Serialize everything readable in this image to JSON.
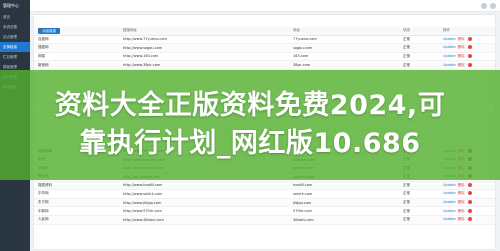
{
  "sidebar": {
    "brand": "管理中心",
    "items": [
      {
        "label": "首页",
        "active": false
      },
      {
        "label": "系统设置",
        "active": false
      },
      {
        "label": "站点管理",
        "active": false
      },
      {
        "label": "友情链接",
        "active": true
      },
      {
        "label": "栏目管理",
        "active": false
      },
      {
        "label": "模板管理",
        "active": false
      },
      {
        "label": "用户管理",
        "active": false
      },
      {
        "label": "数据统计",
        "active": false
      }
    ]
  },
  "toolbar": {
    "add_label": "添加链接"
  },
  "table": {
    "headers": [
      "名称",
      "链接地址",
      "地址",
      "状态",
      "操作"
    ],
    "rows": [
      {
        "name": "百度网",
        "url": "http://www.77yueno.com",
        "url2": "77yueno.com",
        "status": "正常"
      },
      {
        "name": "搜狐网",
        "url": "http://www.sogou.com",
        "url2": "sogou.com",
        "status": "正常"
      },
      {
        "name": "网易",
        "url": "http://www.163.com",
        "url2": "163.com",
        "status": "正常"
      },
      {
        "name": "新浪网",
        "url": "http://www.38pc.com",
        "url2": "38pc.com",
        "status": "正常"
      },
      {
        "name": "",
        "url": "",
        "url2": "",
        "status": ""
      },
      {
        "name": "",
        "url": "",
        "url2": "",
        "status": ""
      },
      {
        "name": "",
        "url": "",
        "url2": "",
        "status": ""
      },
      {
        "name": "",
        "url": "",
        "url2": "",
        "status": ""
      },
      {
        "name": "",
        "url": "",
        "url2": "",
        "status": ""
      },
      {
        "name": "",
        "url": "",
        "url2": "",
        "status": ""
      },
      {
        "name": "",
        "url": "",
        "url2": "",
        "status": ""
      },
      {
        "name": "",
        "url": "",
        "url2": "",
        "status": ""
      },
      {
        "name": "",
        "url": "",
        "url2": "",
        "status": ""
      },
      {
        "name": "网易新闻",
        "url": "http://www.3fcouet.com",
        "url2": "3fcouet.com",
        "status": "正常"
      },
      {
        "name": "新浪",
        "url": "http://www.bosseet.com",
        "url2": "bosseet.com",
        "status": "正常"
      },
      {
        "name": "凤凰网",
        "url": "http://www.jsanch.com",
        "url2": "jsanch.com",
        "status": "正常"
      },
      {
        "name": "腾讯网",
        "url": "http://qq.calibati.com",
        "url2": "calibati.com",
        "status": "正常"
      },
      {
        "name": "搜狐资料",
        "url": "http://www.hoqfill.com",
        "url2": "hoqfill.com",
        "status": "正常"
      },
      {
        "name": "中华网",
        "url": "http://www.soiirrk.com",
        "url2": "soiirrk.com",
        "status": "正常"
      },
      {
        "name": "东方网",
        "url": "http://www.jfdjgo.com",
        "url2": "jfdjgo.com",
        "status": "正常"
      },
      {
        "name": "中新网",
        "url": "http://www.570rh.com",
        "url2": "570rh.com",
        "status": "正常"
      },
      {
        "name": "人民网",
        "url": "http://www.4ilkaks.com",
        "url2": "4ilkaks.com",
        "status": "正常"
      }
    ],
    "op_edit": "Update",
    "op_delete": "删除"
  },
  "banner": {
    "line1": "资料大全正版资料免费2024,可",
    "line2": "靠执行计划_网红版10.686"
  },
  "colors": {
    "sidebar": "#2b3643",
    "accent": "#1f78d1",
    "banner": "#54b02f",
    "danger": "#e24a4a"
  }
}
